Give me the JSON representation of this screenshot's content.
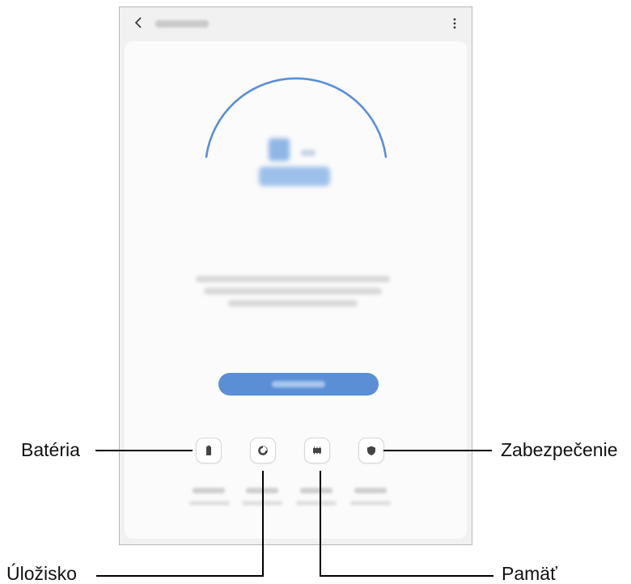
{
  "callouts": {
    "battery": "Batéria",
    "storage": "Úložisko",
    "security": "Zabezpečenie",
    "memory": "Pamäť"
  },
  "colors": {
    "arc": "#5a8fd6",
    "accent_button": "#5a8fd6",
    "frame_background": "#f1f1f1",
    "card_background": "#fbfbfb"
  },
  "icons": {
    "back": "back-arrow-icon",
    "more": "more-options-icon",
    "battery": "battery-icon",
    "storage": "storage-pie-icon",
    "memory": "memory-chip-icon",
    "security": "shield-icon"
  }
}
